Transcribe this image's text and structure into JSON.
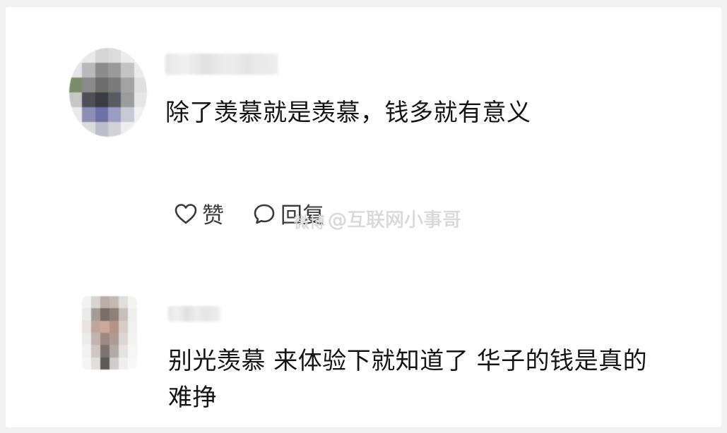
{
  "comments": [
    {
      "username": "",
      "text_lines": [
        "除了羡慕就是羡慕，钱多就有意义"
      ],
      "like_label": "赞",
      "reply_label": "回复"
    },
    {
      "username": "",
      "text_lines": [
        "别光羡慕 来体验下就知道了 华子的钱是真的",
        "难挣"
      ]
    }
  ],
  "watermark": {
    "logo": "微博",
    "text": "@互联网小事哥"
  },
  "icons": {
    "like": "heart-icon",
    "reply": "speech-bubble-icon"
  },
  "colors": {
    "text": "#141414",
    "action": "#3a3a3a",
    "watermark": "#d9d9d9"
  }
}
